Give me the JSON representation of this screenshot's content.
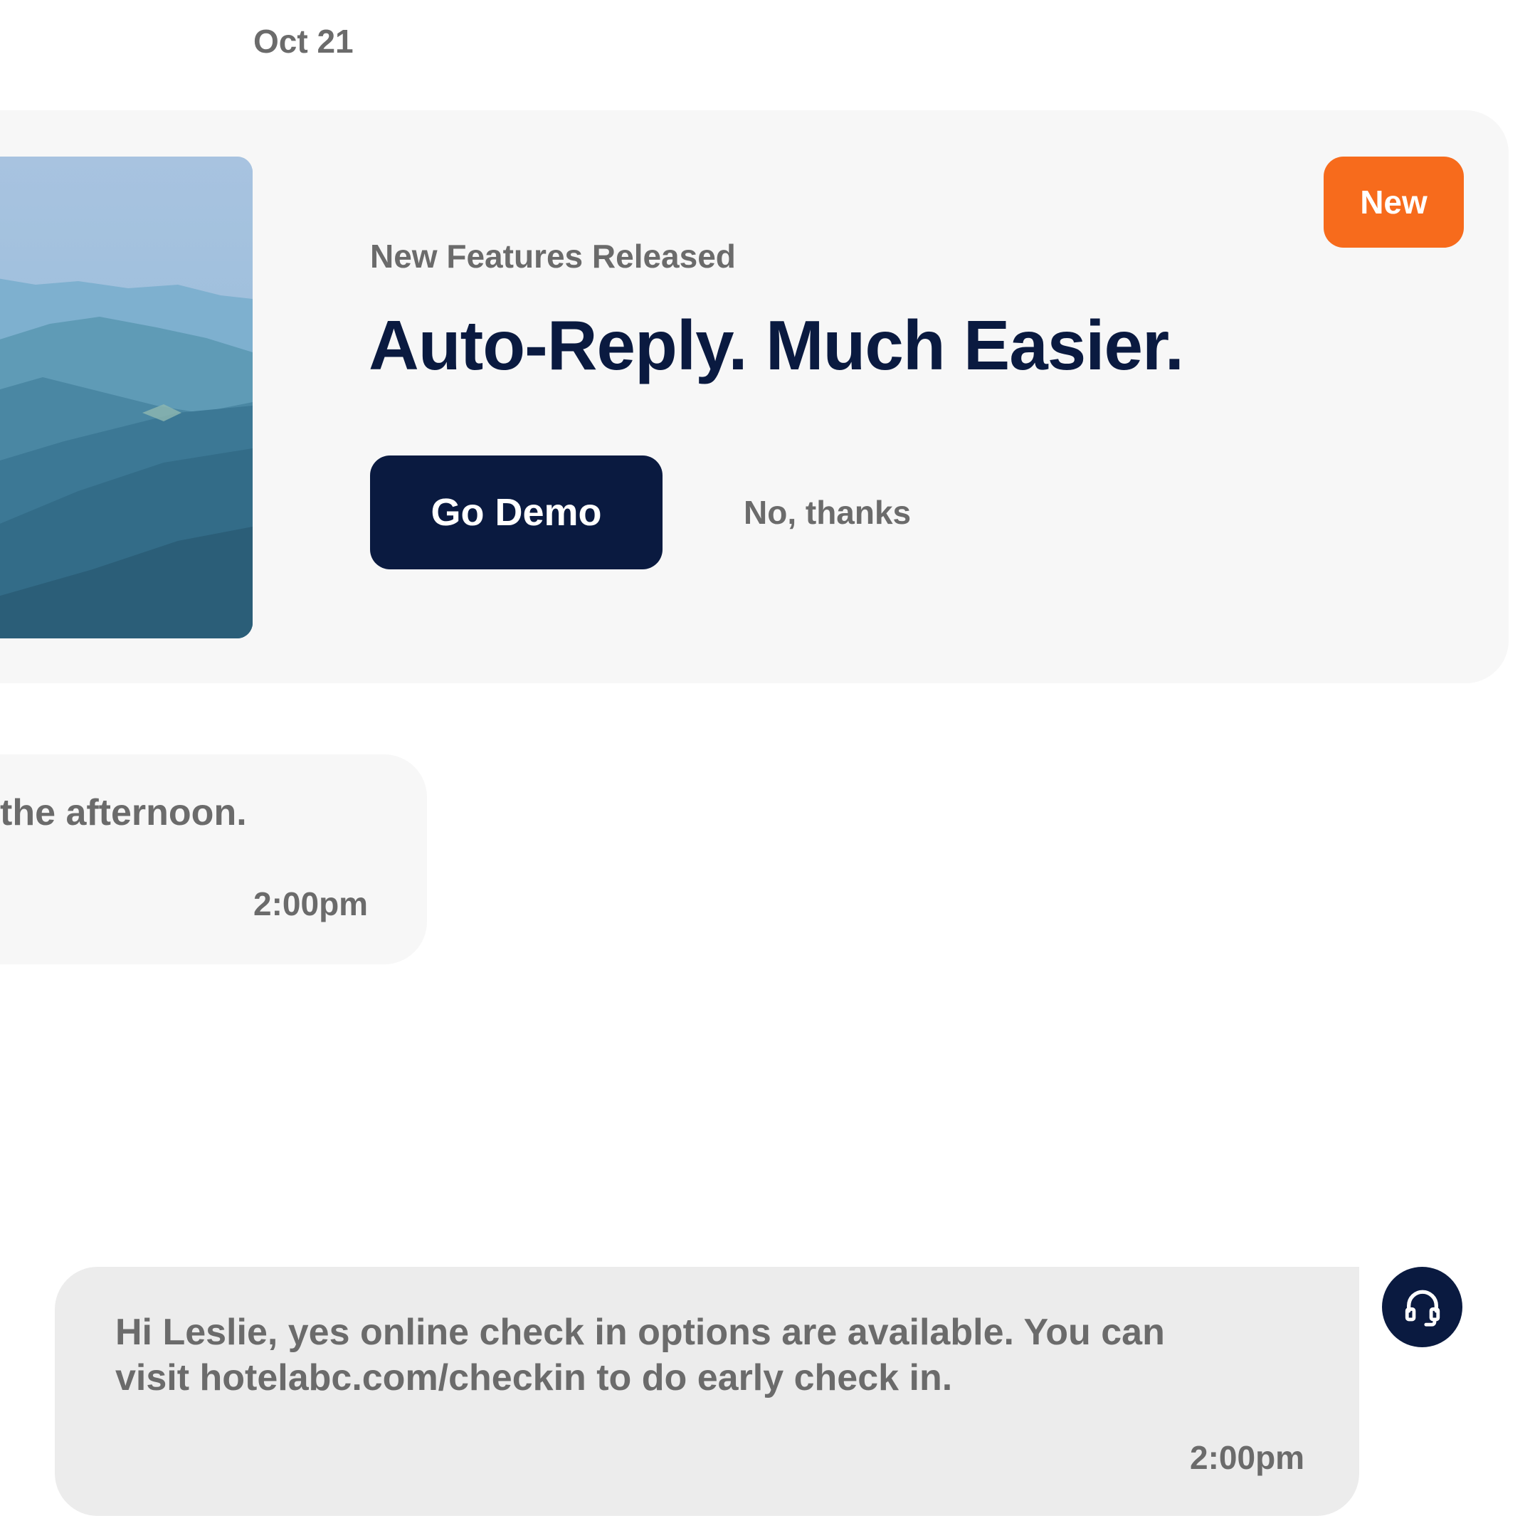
{
  "thread": {
    "date_label": "Oct 21"
  },
  "promo": {
    "badge": "New",
    "eyebrow": "New Features Released",
    "headline": "Auto-Reply. Much Easier.",
    "primary_button": "Go Demo",
    "secondary_button": "No, thanks",
    "image_icon": "mountain-landscape-image"
  },
  "messages": [
    {
      "direction": "incoming",
      "text": "the afternoon.",
      "time": "2:00pm"
    },
    {
      "direction": "outgoing",
      "text": "Hi Leslie, yes online check in options are available. You can visit hotelabc.com/checkin to do early check in.",
      "time": "2:00pm",
      "avatar_icon": "headset-icon"
    }
  ],
  "colors": {
    "navy": "#0a1a40",
    "orange": "#f76b1c",
    "muted_text": "#6b6b6b",
    "card_bg": "#f7f7f7",
    "bubble_out_bg": "#ececec"
  }
}
